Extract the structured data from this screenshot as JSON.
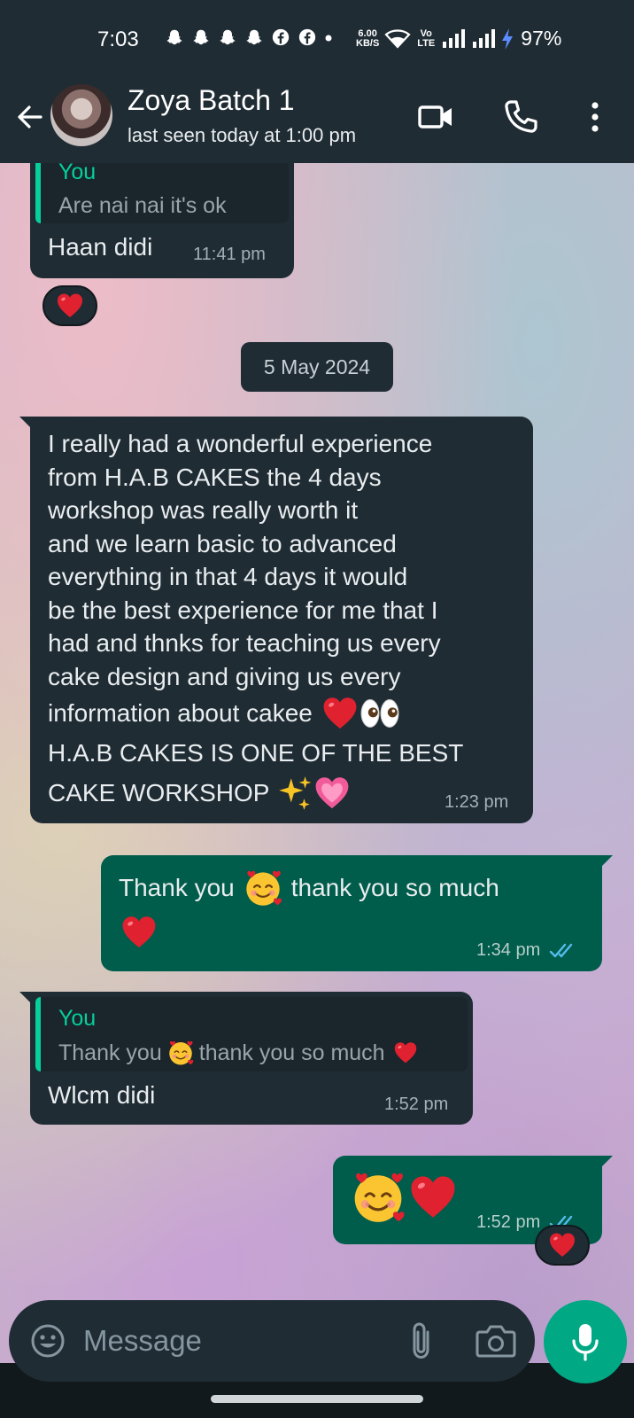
{
  "status_bar": {
    "time": "7:03",
    "net_speed_value": "6.00",
    "net_speed_unit": "KB/S",
    "volte_label": "Vo LTE",
    "battery": "97%"
  },
  "header": {
    "contact_name": "Zoya Batch 1",
    "last_seen": "last seen today at 1:00 pm"
  },
  "chat": {
    "messages": [
      {
        "direction": "incoming",
        "quote_author": "You",
        "quote_text": "Are nai nai it's ok",
        "text": "Haan didi",
        "time": "11:41 pm",
        "reaction": "heart"
      },
      {
        "date_separator": "5 May 2024"
      },
      {
        "direction": "incoming",
        "lines": [
          "I really had a wonderful experience",
          "from H.A.B CAKES the 4 days",
          "workshop was really worth it",
          "and we learn basic to advanced",
          "everything in that 4 days it would",
          "be the best experience for me that I",
          "had and thnks for teaching us every",
          "cake design and giving us every",
          "information about cakee",
          "H.A.B CAKES IS ONE OF THE BEST",
          "CAKE WORKSHOP"
        ],
        "time": "1:23 pm"
      },
      {
        "direction": "outgoing",
        "text_a": "Thank you",
        "text_b": "thank you so much",
        "time": "1:34 pm",
        "status": "read"
      },
      {
        "direction": "incoming",
        "quote_author": "You",
        "quote_text_a": "Thank you",
        "quote_text_b": "thank you so much",
        "text": "Wlcm didi",
        "time": "1:52 pm"
      },
      {
        "direction": "outgoing",
        "emoji_only": true,
        "time": "1:52 pm",
        "status": "read",
        "reaction": "heart"
      }
    ]
  },
  "input": {
    "placeholder": "Message"
  },
  "colors": {
    "header_bg": "#1f2c34",
    "incoming_bubble": "#1f2c34",
    "outgoing_bubble": "#005c4b",
    "accent": "#00a884",
    "quote_accent": "#06cf9c",
    "read_ticks": "#53bdeb"
  },
  "icons": [
    "back-arrow-icon",
    "video-call-icon",
    "voice-call-icon",
    "more-options-icon",
    "emoji-icon",
    "attach-icon",
    "camera-icon",
    "mic-icon",
    "heart-emoji",
    "smiling-hearts-emoji",
    "eyes-emoji",
    "sparkles-emoji",
    "growing-heart-emoji",
    "double-tick-icon"
  ]
}
